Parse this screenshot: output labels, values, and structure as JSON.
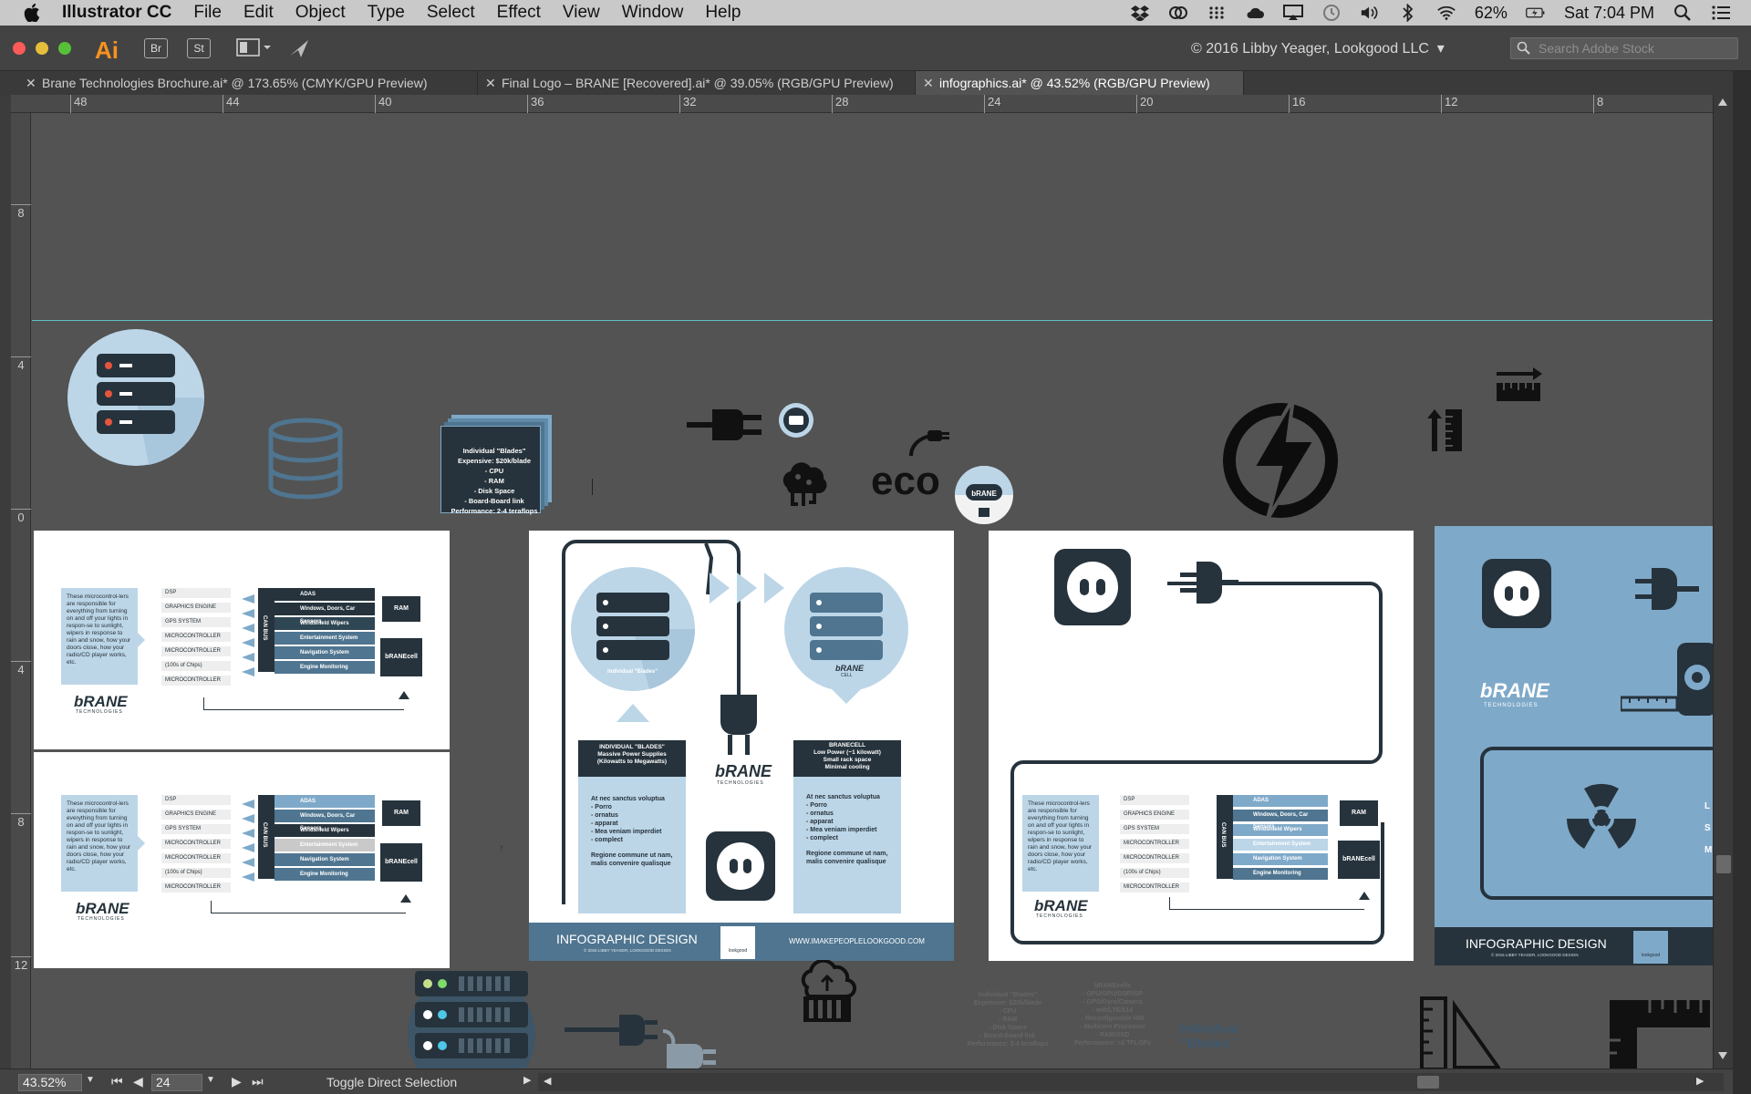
{
  "menubar": {
    "app_name": "Illustrator CC",
    "menus": [
      "File",
      "Edit",
      "Object",
      "Type",
      "Select",
      "Effect",
      "View",
      "Window",
      "Help"
    ],
    "battery": "62%",
    "clock": "Sat 7:04 PM"
  },
  "appbar": {
    "logo": "Ai",
    "bridge_label": "Br",
    "stock_label": "St",
    "copyright": "© 2016 Libby Yeager, Lookgood LLC",
    "search_placeholder": "Search Adobe Stock"
  },
  "tabs": [
    {
      "label": "Brane Technologies Brochure.ai* @ 173.65% (CMYK/GPU Preview)"
    },
    {
      "label": "Final Logo – BRANE [Recovered].ai* @ 39.05% (RGB/GPU Preview)"
    },
    {
      "label": "infographics.ai* @ 43.52% (RGB/GPU Preview)"
    }
  ],
  "ruler": {
    "h_labels": [
      "48",
      "44",
      "40",
      "36",
      "32",
      "28",
      "24",
      "20",
      "16",
      "12",
      "8"
    ],
    "v_labels": [
      "8",
      "4",
      "0",
      "4",
      "8",
      "12"
    ]
  },
  "artwork": {
    "blades_card": [
      "Individual \"Blades\"",
      "Expensive: $20k/blade",
      "- CPU",
      "- RAM",
      "- Disk Space",
      "- Board-Board link",
      "Performance: 2-4 teraflops"
    ],
    "eco_label": "eco",
    "brane_logo": "bRANE",
    "brane_sub": "TECHNOLOGIES",
    "microcontroller_text": "These microcontrol-lers are responsible for everything from turning on and off your lights in respon-se to sunlight, wipers in response to rain and snow, how your doors close, how your radio/CD player works, etc.",
    "chip_list": [
      "DSP",
      "GRAPHICS ENGINE",
      "GPS SYSTEM",
      "MICROCONTROLLER",
      "MICROCONTROLLER",
      "(100s of Chips)",
      "MICROCONTROLLER"
    ],
    "can_bus": "CAN BUS",
    "bus_items": [
      "ADAS",
      "Windows, Doors, Car Sensors",
      "Windshield Wipers",
      "Entertainment System",
      "Navigation System",
      "Engine Monitoring Instrumentation"
    ],
    "ram": "RAM",
    "branecell": "bRANEcell",
    "blades_title": "INDIVIDUAL \"BLADES\"",
    "blades_sub": [
      "Massive Power Supplies",
      "(Kilowatts to Megawatts)"
    ],
    "branecell_title": "BRANECELL",
    "branecell_sub": [
      "Low Power (~1 kilowatt)",
      "Small rack space",
      "Minimal cooling"
    ],
    "lorem_title": "At nec sanctus voluptua",
    "lorem_items": [
      "- Porro",
      "- ornatus",
      "- apparat",
      "- Mea veniam imperdiet",
      "- complect"
    ],
    "lorem_footer": [
      "Regione commune ut nam,",
      "malis convenire qualisque"
    ],
    "server_caption": "Individual \"Blades\"",
    "cell_caption": "CELL",
    "footer_title": "INFOGRAPHIC DESIGN",
    "footer_copy": "© 2016 LIBBY YEAGER, LOOKGOOD DESIGN",
    "footer_url": "WWW.IMAKEPEOPLELOOKGOOD.COM",
    "lookgood": "lookgood",
    "right_letters": [
      "L",
      "S",
      "M"
    ],
    "bottom_blades": [
      "Individual \"Blades\"",
      "Expensive: $20k/blade",
      "- CPU",
      "- RAM",
      "- Disk Space",
      "- Board-Board link",
      "Performance: 2-4 teraflops"
    ],
    "bottom_branecells": [
      "bRANEcells",
      "- GPU/GPU/DSP/ISP",
      "- GPS/Gyro/Camera",
      "- wifi/LTE/814",
      "- Reconfigurable HW",
      "- Multicore Processor",
      "- RAM/SSD",
      "Performance: >2 TFLOPs"
    ],
    "bottom_individual": [
      "Individual",
      "\"Blades\""
    ]
  },
  "statusbar": {
    "zoom": "43.52%",
    "page": "24",
    "tool": "Toggle Direct Selection"
  },
  "colors": {
    "accent_blue": "#7fa9c9",
    "light_blue": "#bcd6e8",
    "navy": "#26333c",
    "steel": "#4f7590"
  }
}
